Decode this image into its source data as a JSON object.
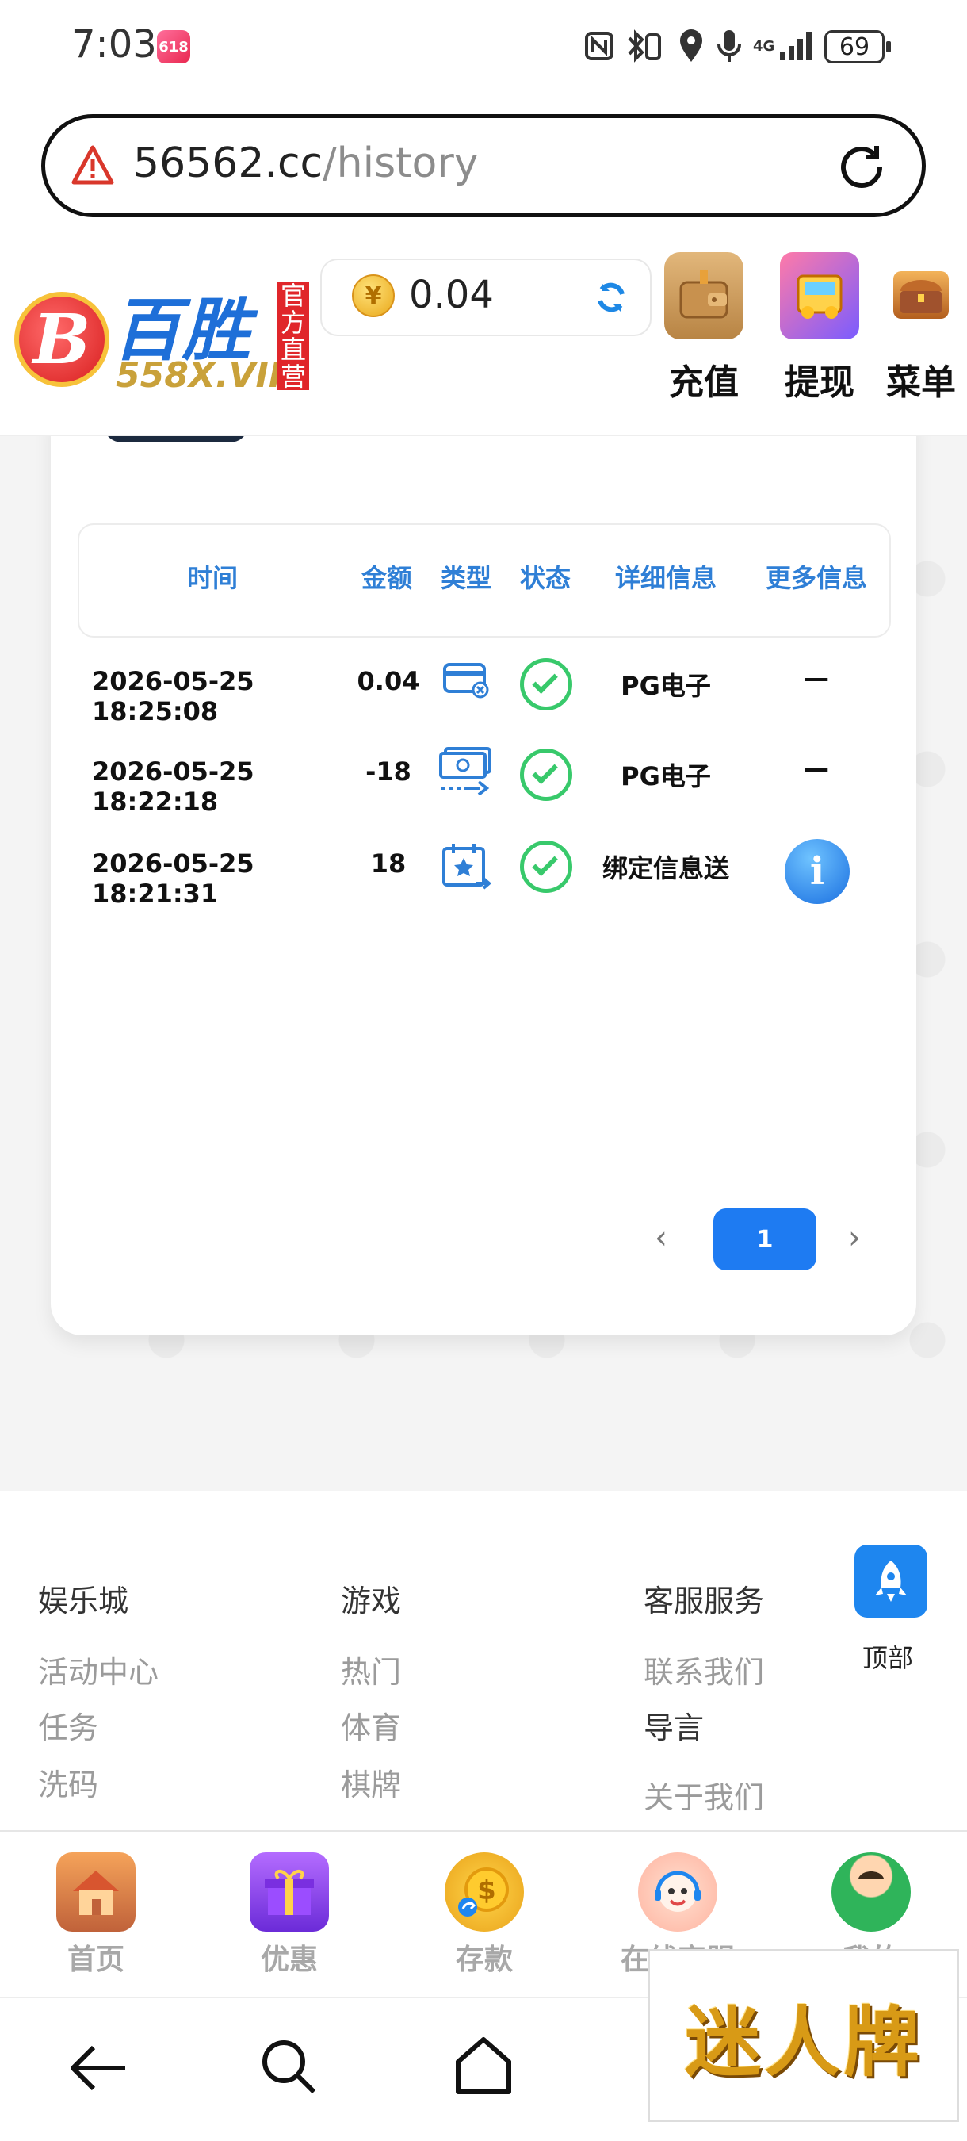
{
  "status_bar": {
    "time": "7:03",
    "app_badge": "618",
    "network": "4G",
    "battery": "69"
  },
  "url_bar": {
    "domain": "56562.cc",
    "path": "/history"
  },
  "header": {
    "logo_name": "百胜",
    "logo_domain": "558X.VIP",
    "logo_official": [
      "官",
      "方",
      "直",
      "营"
    ],
    "balance": "0.04",
    "coin_symbol": "¥",
    "buttons": {
      "deposit": "充值",
      "withdraw": "提现",
      "menu": "菜单"
    }
  },
  "history_table": {
    "columns": [
      "时间",
      "金额",
      "类型",
      "状态",
      "详细信息",
      "更多信息"
    ],
    "rows": [
      {
        "time": "2026-05-25 18:25:08",
        "amount": "0.04",
        "type_icon": "card-icon",
        "status": "success",
        "detail": "PG电子",
        "more": "—"
      },
      {
        "time": "2026-05-25 18:22:18",
        "amount": "-18",
        "type_icon": "cash-transfer-icon",
        "status": "success",
        "detail": "PG电子",
        "more": "—"
      },
      {
        "time": "2026-05-25 18:21:31",
        "amount": "18",
        "type_icon": "calendar-star-icon",
        "status": "success",
        "detail": "绑定信息送",
        "more": "info-icon"
      }
    ],
    "pagination": {
      "prev": "‹",
      "current": "1",
      "next": "›"
    }
  },
  "footer": {
    "columns": [
      {
        "title": "娱乐城",
        "links": [
          "活动中心",
          "任务",
          "洗码"
        ]
      },
      {
        "title": "游戏",
        "links": [
          "热门",
          "体育",
          "棋牌"
        ]
      },
      {
        "title": "客服服务",
        "links": [
          "联系我们",
          "导言",
          "关于我们"
        ]
      }
    ],
    "to_top": "顶部"
  },
  "tab_bar": [
    "首页",
    "优惠",
    "存款",
    "在线客服",
    "我的"
  ],
  "ad_overlay": "迷人牌",
  "colors": {
    "accent_blue": "#1e7bf2",
    "header_text_blue": "#2f7fd6",
    "success_green": "#38c96b"
  }
}
